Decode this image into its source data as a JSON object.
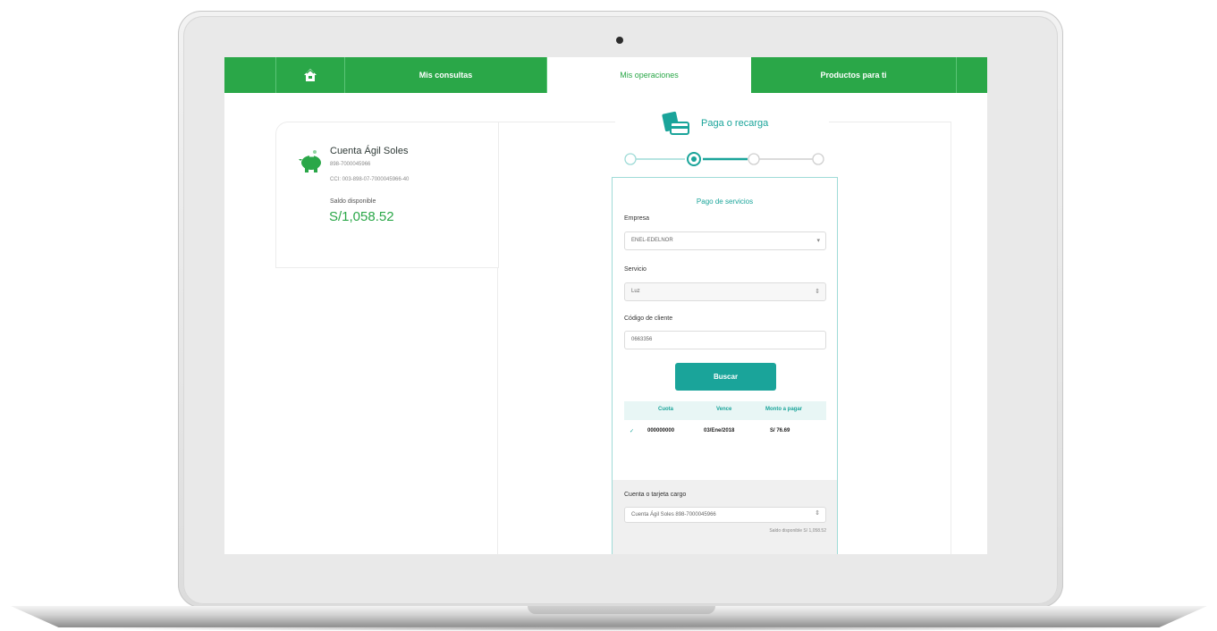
{
  "nav": {
    "consultas": "Mis consultas",
    "operaciones": "Mis operaciones",
    "productos": "Productos para ti"
  },
  "account": {
    "name": "Cuenta Ágil Soles",
    "number": "898-7000045966",
    "cci": "CCI: 003-898-07-7000045966-40",
    "balance_label": "Saldo disponible",
    "balance": "S/1,058.52"
  },
  "operation": {
    "title": "Paga o recarga",
    "steps_total": 4,
    "current_step": 2
  },
  "form": {
    "section_title": "Pago de servicios",
    "empresa_label": "Empresa",
    "empresa_value": "ENEL-EDELNOR",
    "servicio_label": "Servicio",
    "servicio_value": "Luz",
    "codigo_label": "Código de cliente",
    "codigo_value": "0663356",
    "search_button": "Buscar"
  },
  "table": {
    "headers": [
      "Cuota",
      "Vence",
      "Monto a pagar"
    ],
    "rows": [
      {
        "cuota": "000000000",
        "vence": "03/Ene/2018",
        "monto": "S/ 76.69"
      }
    ]
  },
  "charge": {
    "label": "Cuenta o tarjeta cargo",
    "value": "Cuenta Ágil Soles 898-7000045966",
    "saldo": "Saldo disponible S/ 1,058.52"
  },
  "colors": {
    "brand_green": "#2aa748",
    "teal": "#1aa49a"
  }
}
